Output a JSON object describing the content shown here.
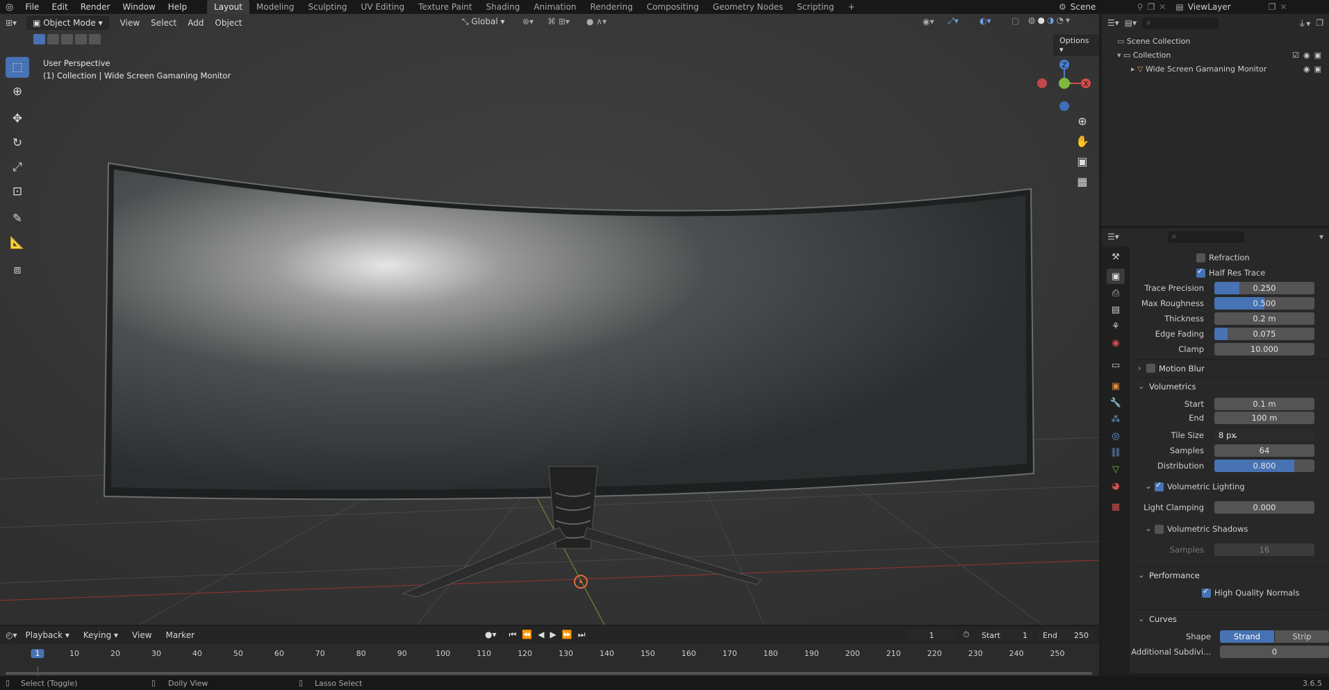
{
  "topbar": {
    "menus": [
      "File",
      "Edit",
      "Render",
      "Window",
      "Help"
    ],
    "workspaces": [
      "Layout",
      "Modeling",
      "Sculpting",
      "UV Editing",
      "Texture Paint",
      "Shading",
      "Animation",
      "Rendering",
      "Compositing",
      "Geometry Nodes",
      "Scripting"
    ],
    "active_workspace": "Layout",
    "add_tab": "+",
    "scene_label": "Scene",
    "viewlayer_label": "ViewLayer"
  },
  "viewport": {
    "mode_label": "Object Mode",
    "menus": [
      "View",
      "Select",
      "Add",
      "Object"
    ],
    "transform_orientation": "Global",
    "options_label": "Options",
    "overlay_title": "User Perspective",
    "overlay_subtitle": "(1) Collection | Wide Screen Gamaning Monitor",
    "gizmo_axes": {
      "z": "Z",
      "x": "X",
      "y": "Y"
    }
  },
  "outliner": {
    "items": [
      {
        "label": "Scene Collection"
      },
      {
        "label": "Collection"
      },
      {
        "label": "Wide Screen Gamaning Monitor"
      }
    ]
  },
  "properties": {
    "refraction_label": "Refraction",
    "half_res_label": "Half Res Trace",
    "trace_precision": {
      "label": "Trace Precision",
      "value": "0.250",
      "fraction": 0.25
    },
    "max_roughness": {
      "label": "Max Roughness",
      "value": "0.500",
      "fraction": 0.5
    },
    "thickness": {
      "label": "Thickness",
      "value": "0.2 m"
    },
    "edge_fading": {
      "label": "Edge Fading",
      "value": "0.075",
      "fraction": 0.13
    },
    "clamp": {
      "label": "Clamp",
      "value": "10.000"
    },
    "motion_blur_label": "Motion Blur",
    "volumetrics_label": "Volumetrics",
    "start": {
      "label": "Start",
      "value": "0.1 m"
    },
    "end": {
      "label": "End",
      "value": "100 m"
    },
    "tile_size": {
      "label": "Tile Size",
      "value": "8 px"
    },
    "samples": {
      "label": "Samples",
      "value": "64"
    },
    "distribution": {
      "label": "Distribution",
      "value": "0.800",
      "fraction": 0.8
    },
    "vol_lighting_label": "Volumetric Lighting",
    "light_clamping": {
      "label": "Light Clamping",
      "value": "0.000"
    },
    "vol_shadows_label": "Volumetric Shadows",
    "shadow_samples": {
      "label": "Samples",
      "value": "16"
    },
    "performance_label": "Performance",
    "hq_normals_label": "High Quality Normals",
    "curves_label": "Curves",
    "shape_label": "Shape",
    "shape_strand": "Strand",
    "shape_strip": "Strip",
    "add_subdiv": {
      "label": "Additional Subdivi...",
      "value": "0"
    }
  },
  "timeline": {
    "menus": [
      "Playback",
      "Keying",
      "View",
      "Marker"
    ],
    "current_frame": "1",
    "start_label": "Start",
    "start_value": "1",
    "end_label": "End",
    "end_value": "250",
    "ticks": [
      "1",
      "10",
      "20",
      "30",
      "40",
      "50",
      "60",
      "70",
      "80",
      "90",
      "100",
      "110",
      "120",
      "130",
      "140",
      "150",
      "160",
      "170",
      "180",
      "190",
      "200",
      "210",
      "220",
      "230",
      "240",
      "250"
    ]
  },
  "statusbar": {
    "select": "Select (Toggle)",
    "dolly": "Dolly View",
    "lasso": "Lasso Select",
    "version": "3.6.5"
  }
}
